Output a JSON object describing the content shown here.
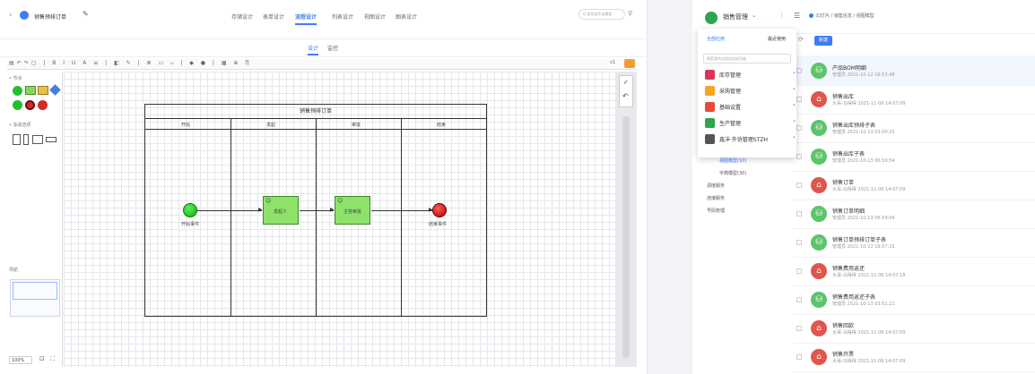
{
  "designer": {
    "title": "销售预排订单",
    "tabs": [
      "存储设计",
      "表单设计",
      "流程设计",
      "列表设计",
      "视图设计",
      "图表设计"
    ],
    "active_tab": "流程设计",
    "search_placeholder": "Q 查找组件或模板",
    "subtabs": [
      "设计",
      "监控"
    ],
    "palette": {
      "section1": "• 节点",
      "section2": "• 泳道选项",
      "nav_label": "导航"
    },
    "zoom": "100%",
    "version": "v1",
    "diagram": {
      "title": "销售预排订单",
      "lanes": [
        "开始",
        "发起",
        "审批",
        "结束"
      ],
      "nodes": {
        "start": "开始事件",
        "task1": "发起人",
        "task2": "主管审批",
        "end": "结束事件"
      }
    }
  },
  "app": {
    "name": "销售管理",
    "breadcrumb": "幻灯片 / 销售信息 / 视图模型",
    "new_button": "新建",
    "menu": {
      "tab_all": "全部应用",
      "tab_recent": "最近使用",
      "search_placeholder": "搜索我的全部应用或功能",
      "items": [
        {
          "label": "库存管理",
          "color": "#d9365a"
        },
        {
          "label": "采购管理",
          "color": "#f5a623"
        },
        {
          "label": "基础设置",
          "color": "#e84a3c"
        },
        {
          "label": "生产管理",
          "color": "#2ea44f"
        },
        {
          "label": "鑫沣·外协管理STZH",
          "color": "#555555"
        }
      ]
    },
    "sidebar": [
      "视图模型(10)",
      "字典模型(30)",
      "调度服务",
      "连接服务",
      "号码管理"
    ],
    "rows": [
      {
        "title": "产品BOM明细",
        "sub": "管理员 2021-10-12 16:53:48",
        "type": "green"
      },
      {
        "title": "销售出库",
        "sub": "大哥-马得得 2021-11-06 14:07:09",
        "type": "red"
      },
      {
        "title": "销售出库预排子表",
        "sub": "管理员 2021-10-13 03:00:25",
        "type": "green"
      },
      {
        "title": "销售出库子表",
        "sub": "管理员 2021-10-13 06:59:54",
        "type": "green"
      },
      {
        "title": "销售订单",
        "sub": "大哥-马得得 2021-11-06 14:07:09",
        "type": "red"
      },
      {
        "title": "销售订单明细",
        "sub": "管理员 2021-10-13 06:59:04",
        "type": "green"
      },
      {
        "title": "销售订单预排订单子表",
        "sub": "管理员 2021-10-22 16:07:15",
        "type": "green"
      },
      {
        "title": "销售费用返还",
        "sub": "大哥-马得得 2021-11-06 14:07:18",
        "type": "red"
      },
      {
        "title": "销售费用返还子表",
        "sub": "管理员 2021-10-13 03:01:21",
        "type": "green"
      },
      {
        "title": "销售回款",
        "sub": "大哥-马得得 2021-11-06 14:07:09",
        "type": "red"
      },
      {
        "title": "销售开票",
        "sub": "大哥-马得得 2021-11-06 14:07:09",
        "type": "red"
      }
    ]
  }
}
